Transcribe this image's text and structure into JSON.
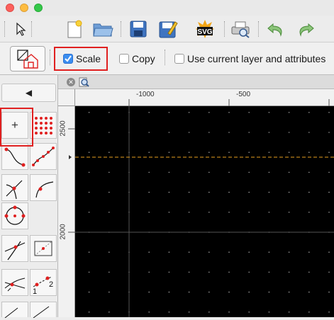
{
  "window": {
    "controls": [
      "close",
      "minimize",
      "zoom"
    ]
  },
  "toolbar": {
    "buttons": [
      "select-pointer",
      "new-file",
      "open-folder",
      "save",
      "save-as",
      "export-svg",
      "print-preview",
      "undo",
      "redo"
    ],
    "svg_badge": "SVG"
  },
  "options": {
    "scale_label": "Scale",
    "scale_checked": true,
    "copy_label": "Copy",
    "copy_checked": false,
    "use_current_label": "Use current layer and attributes",
    "use_current_checked": false
  },
  "tools": {
    "back_arrow": "◀",
    "crosshair": "+",
    "spline_numbers": [
      "1",
      "2"
    ]
  },
  "rulers": {
    "horizontal": [
      "-1000",
      "-500"
    ],
    "vertical": [
      "2500",
      "2000"
    ]
  },
  "colors": {
    "highlight": "#e02020",
    "canvas": "#000000",
    "guide": "#e8a020",
    "accent": "#3b8ef0"
  }
}
